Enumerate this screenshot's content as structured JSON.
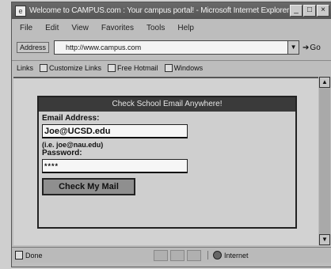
{
  "window": {
    "title": "Welcome to CAMPUS.com : Your campus portal! - Microsoft Internet Explorer",
    "icon_glyph": "e",
    "controls": [
      "_",
      "□",
      "×"
    ]
  },
  "menu": [
    "File",
    "Edit",
    "View",
    "Favorites",
    "Tools",
    "Help"
  ],
  "address": {
    "label": "Address",
    "url": "http://www.campus.com",
    "go_label": "Go"
  },
  "links": {
    "label": "Links",
    "items": [
      "Customize Links",
      "Free Hotmail",
      "Windows"
    ]
  },
  "form": {
    "header": "Check School Email Anywhere!",
    "email_label": "Email Address:",
    "email_value": "Joe@UCSD.edu",
    "hint": "(i.e. joe@nau.edu)",
    "password_label": "Password:",
    "password_value": "****",
    "submit_label": "Check My Mail"
  },
  "status": {
    "text": "Done",
    "zone": "Internet"
  }
}
